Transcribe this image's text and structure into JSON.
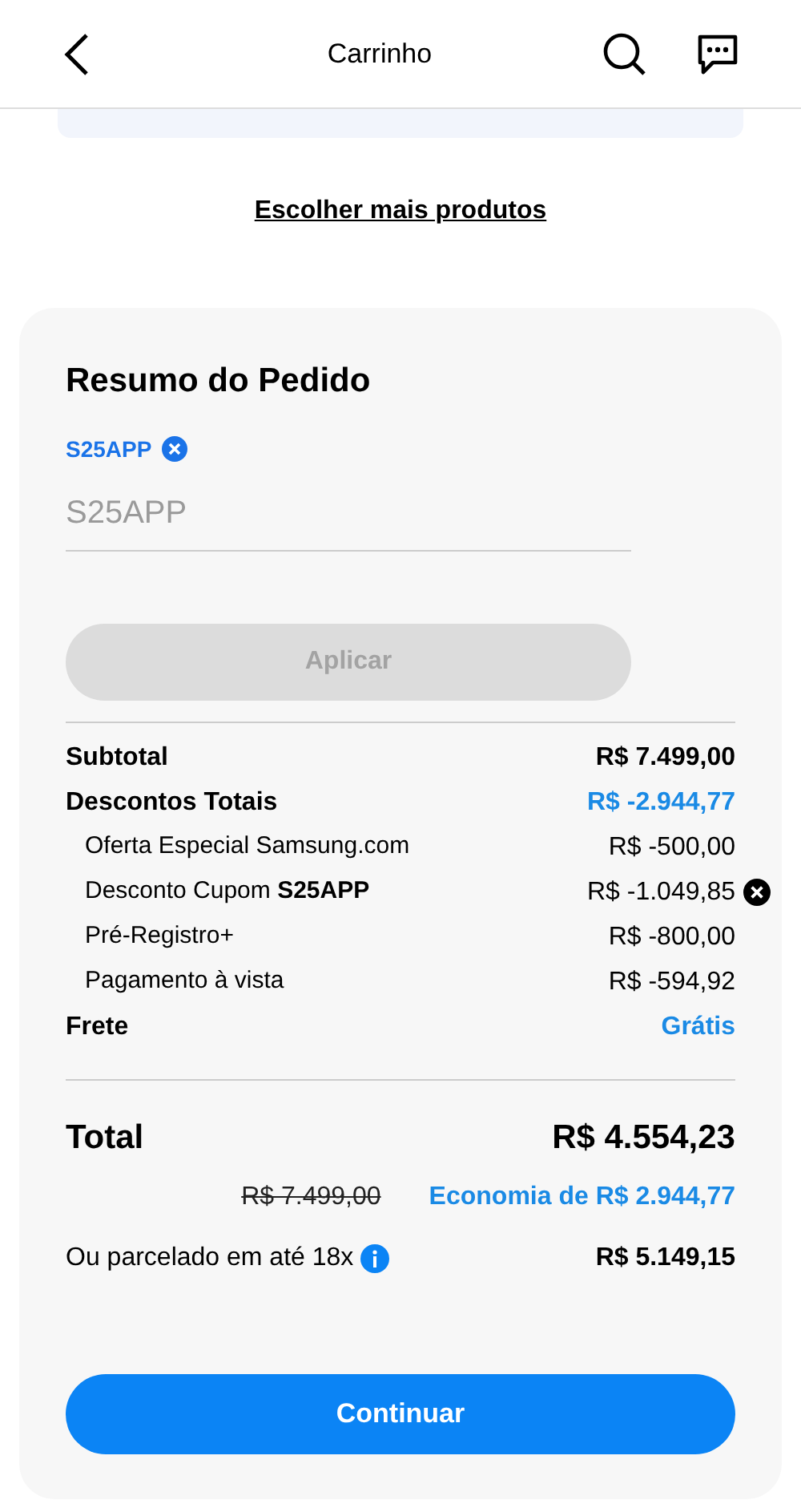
{
  "header": {
    "title": "Carrinho"
  },
  "more_products_link": "Escolher mais produtos",
  "summary": {
    "title": "Resumo do Pedido",
    "applied_coupon": "S25APP",
    "coupon_field": {
      "placeholder": "S25APP"
    },
    "apply_button": {
      "label": "Aplicar",
      "disabled": true
    },
    "lines": [
      {
        "kind": "main",
        "label": "Subtotal",
        "value": "R$ 7.499,00",
        "highlight": false,
        "removable": false
      },
      {
        "kind": "main",
        "label": "Descontos Totais",
        "value": "R$ -2.944,77",
        "highlight": true,
        "removable": false
      },
      {
        "kind": "sub",
        "label": "Oferta Especial Samsung.com",
        "value": "R$ -500,00",
        "highlight": false,
        "removable": false
      },
      {
        "kind": "sub",
        "label": "Desconto Cupom **S25APP**",
        "value": "R$ -1.049,85",
        "highlight": false,
        "removable": true
      },
      {
        "kind": "sub",
        "label": "Pré-Registro+",
        "value": "R$ -800,00",
        "highlight": false,
        "removable": false
      },
      {
        "kind": "sub",
        "label": "Pagamento à vista",
        "value": "R$ -594,92",
        "highlight": false,
        "removable": false
      },
      {
        "kind": "main",
        "label": "Frete",
        "value": "Grátis",
        "highlight": true,
        "removable": false
      }
    ],
    "total_label": "Total",
    "total_value": "R$ 4.554,23",
    "original_price": "R$ 7.499,00",
    "savings": "Economia de R$ 2.944,77",
    "installment_label": "Ou parcelado em até 18x",
    "installment_value": "R$ 5.149,15",
    "continue_button": "Continuar"
  }
}
